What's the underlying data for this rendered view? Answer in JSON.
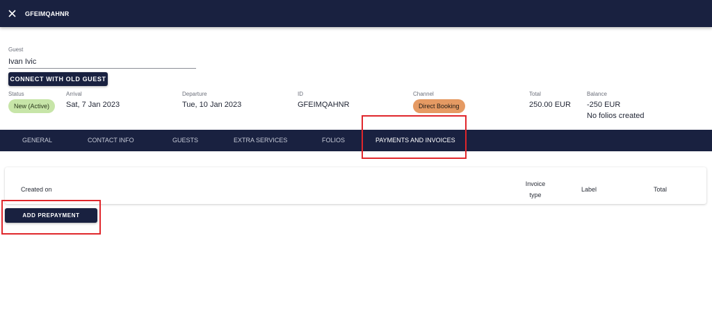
{
  "header": {
    "title": "GFEIMQAHNR",
    "close_icon": "close-icon"
  },
  "guest": {
    "label": "Guest",
    "value": "Ivan Ivic",
    "connect_button": "CONNECT WITH OLD GUEST"
  },
  "info": {
    "status": {
      "label": "Status",
      "value": "New (Active)",
      "color": "#c7e5a8"
    },
    "arrival": {
      "label": "Arrival",
      "value": "Sat, 7 Jan 2023"
    },
    "departure": {
      "label": "Departure",
      "value": "Tue, 10 Jan 2023"
    },
    "id": {
      "label": "ID",
      "value": "GFEIMQAHNR"
    },
    "channel": {
      "label": "Channel",
      "value": "Direct Booking",
      "color": "#e59a63"
    },
    "total": {
      "label": "Total",
      "value": "250.00 EUR"
    },
    "balance": {
      "label": "Balance",
      "value": "-250 EUR",
      "note": "No folios created"
    }
  },
  "tabs": [
    {
      "label": "GENERAL"
    },
    {
      "label": "CONTACT INFO"
    },
    {
      "label": "GUESTS"
    },
    {
      "label": "EXTRA SERVICES"
    },
    {
      "label": "FOLIOS"
    },
    {
      "label": "PAYMENTS AND INVOICES",
      "active": true
    }
  ],
  "table": {
    "columns": {
      "created_on": "Created on",
      "invoice_type_line1": "Invoice",
      "invoice_type_line2": "type",
      "label": "Label",
      "total": "Total"
    }
  },
  "actions": {
    "add_prepayment": "ADD PREPAYMENT"
  },
  "colors": {
    "navy": "#192140",
    "highlight": "#e0262b"
  }
}
